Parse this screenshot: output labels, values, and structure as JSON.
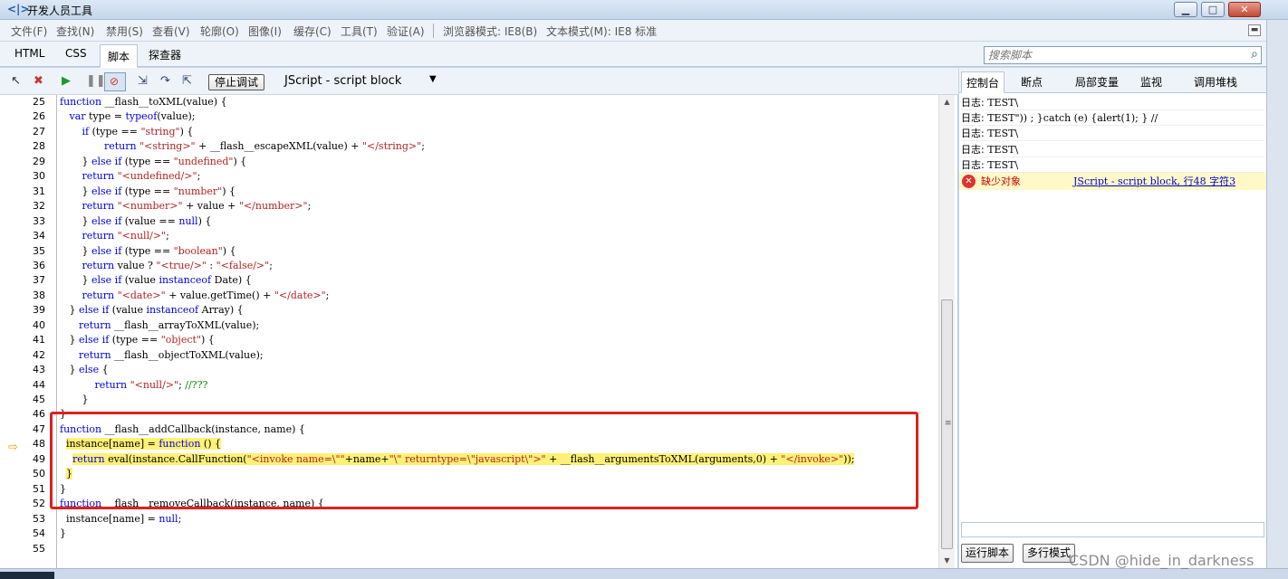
{
  "window": {
    "title": "开发人员工具",
    "app_icon": "<|>",
    "buttons": {
      "minimize": "▁",
      "maximize": "□",
      "close": "✕"
    }
  },
  "menubar": {
    "items": [
      "文件(F)",
      "查找(N)",
      "禁用(S)",
      "查看(V)",
      "轮廓(O)",
      "图像(I)",
      "缓存(C)",
      "工具(T)",
      "验证(A)"
    ],
    "browser_mode": "浏览器模式: IE8(B)",
    "doc_mode": "文本模式(M): IE8 标准"
  },
  "tabs": [
    "HTML",
    "CSS",
    "脚本",
    "探查器"
  ],
  "active_tab": "脚本",
  "search": {
    "placeholder": "搜索脚本"
  },
  "toolbar": {
    "stop_label": "停止调试",
    "script_selector": "JScript - script block"
  },
  "code": {
    "lines": [
      {
        "n": "25",
        "t": "function __flash__toXML(value) {"
      },
      {
        "n": "26",
        "t": "   var type = typeof(value);"
      },
      {
        "n": "27",
        "t": "       if (type == \"string\") {"
      },
      {
        "n": "28",
        "t": "              return \"<string>\" + __flash__escapeXML(value) + \"</string>\";"
      },
      {
        "n": "29",
        "t": "       } else if (type == \"undefined\") {"
      },
      {
        "n": "30",
        "t": "       return \"<undefined/>\";"
      },
      {
        "n": "31",
        "t": "       } else if (type == \"number\") {"
      },
      {
        "n": "32",
        "t": "       return \"<number>\" + value + \"</number>\";"
      },
      {
        "n": "33",
        "t": "       } else if (value == null) {"
      },
      {
        "n": "34",
        "t": "       return \"<null/>\";"
      },
      {
        "n": "35",
        "t": "       } else if (type == \"boolean\") {"
      },
      {
        "n": "36",
        "t": "       return value ? \"<true/>\" : \"<false/>\";"
      },
      {
        "n": "37",
        "t": "       } else if (value instanceof Date) {"
      },
      {
        "n": "38",
        "t": "       return \"<date>\" + value.getTime() + \"</date>\";"
      },
      {
        "n": "39",
        "t": "   } else if (value instanceof Array) {"
      },
      {
        "n": "40",
        "t": "      return __flash__arrayToXML(value);"
      },
      {
        "n": "41",
        "t": "   } else if (type == \"object\") {"
      },
      {
        "n": "42",
        "t": "      return __flash__objectToXML(value);"
      },
      {
        "n": "43",
        "t": "   } else {"
      },
      {
        "n": "44",
        "t": "           return \"<null/>\"; //???"
      },
      {
        "n": "45",
        "t": "       }"
      },
      {
        "n": "46",
        "t": "}"
      },
      {
        "n": "47",
        "t": "function __flash__addCallback(instance, name) {"
      },
      {
        "n": "48",
        "t": "  instance[name] = function () {"
      },
      {
        "n": "49",
        "t": "    return eval(instance.CallFunction(\"<invoke name=\\\"\"+name+\"\\\" returntype=\\\"javascript\\\">\" + __flash__argumentsToXML(arguments,0) + \"</invoke>\"));"
      },
      {
        "n": "50",
        "t": "  }"
      },
      {
        "n": "51",
        "t": "}"
      },
      {
        "n": "52",
        "t": "function __flash__removeCallback(instance, name) {"
      },
      {
        "n": "53",
        "t": "  instance[name] = null;"
      },
      {
        "n": "54",
        "t": "}"
      },
      {
        "n": "55",
        "t": ""
      }
    ],
    "current_line": "48",
    "highlighted_lines": [
      "48",
      "49",
      "50"
    ]
  },
  "console": {
    "tabs": [
      "控制台",
      "断点",
      "局部变量",
      "监视",
      "调用堆栈"
    ],
    "active_tab": "控制台",
    "logs": [
      {
        "prefix": "日志:",
        "text": "TEST\\"
      },
      {
        "prefix": "日志:",
        "text": "TEST\")) ; }catch (e) {alert(1); } //"
      },
      {
        "prefix": "日志:",
        "text": "TEST\\"
      },
      {
        "prefix": "日志:",
        "text": "TEST\\"
      },
      {
        "prefix": "日志:",
        "text": "TEST\\"
      }
    ],
    "error": {
      "message": "缺少对象",
      "link": "JScript - script block, 行48 字符3"
    },
    "run_button": "运行脚本",
    "multiline_button": "多行模式"
  },
  "watermark": "CSDN @hide_in_darkness",
  "colors": {
    "highlight": "#fff176",
    "annotation_box": "#e02020",
    "keyword": "#0000e0",
    "string": "#b22222",
    "comment": "#008000"
  }
}
